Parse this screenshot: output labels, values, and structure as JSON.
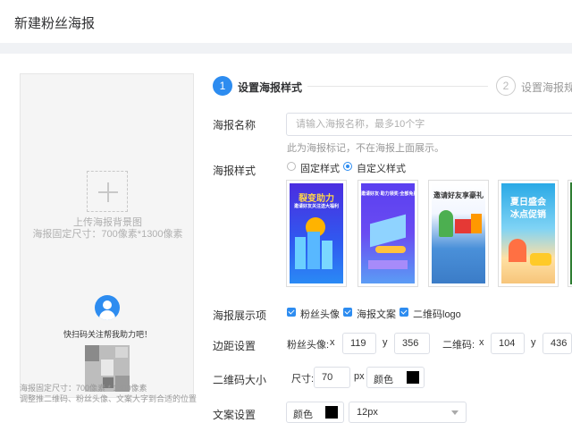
{
  "page": {
    "title": "新建粉丝海报"
  },
  "preview": {
    "upload_title": "上传海报背景图",
    "upload_size": "海报固定尺寸：700像素*1300像素",
    "scan_text": "快扫码关注帮我助力吧！",
    "hint1": "海报固定尺寸：700像素 * 1300像素",
    "hint2": "调整推二维码、粉丝头像、文案大字到合适的位置"
  },
  "steps": [
    {
      "number": "1",
      "label": "设置海报样式",
      "active": true
    },
    {
      "number": "2",
      "label": "设置海报规则",
      "active": false
    }
  ],
  "form": {
    "name_label": "海报名称",
    "name_placeholder": "请输入海报名称，最多10个字",
    "name_helper": "此为海报标记，不在海报上面展示。",
    "style_label": "海报样式",
    "style_options": [
      "固定样式",
      "自定义样式"
    ],
    "style_selected": "自定义样式",
    "templates": [
      {
        "caption": "裂变助力",
        "sub": "邀请好友关注送大福利",
        "color": "#3a3ce0"
      },
      {
        "caption": "",
        "sub": "邀请好友·助力领奖·全部免费",
        "color": "#5b47e8"
      },
      {
        "caption": "邀请好友享豪礼",
        "sub": "",
        "color": "#4a90d9"
      },
      {
        "caption": "夏日盛会",
        "sub": "冰点促销",
        "color": "#29a9e6"
      }
    ],
    "display_label": "海报展示项",
    "display_options": [
      "粉丝头像",
      "海报文案",
      "二维码logo"
    ],
    "margin_label": "边距设置",
    "avatar_label": "粉丝头像:",
    "avatar_x": "119",
    "avatar_y": "356",
    "qr_label": "二维码:",
    "qr_x": "104",
    "qr_y": "436",
    "x_label": "x",
    "y_label": "y",
    "qr_size_label": "二维码大小",
    "size_label": "尺寸:",
    "size_value": "70",
    "size_unit": "px",
    "color_label": "颜色",
    "qr_color": "#000000",
    "text_label": "文案设置",
    "text_color_label": "颜色",
    "text_color": "#000000",
    "font_size": "12px"
  }
}
